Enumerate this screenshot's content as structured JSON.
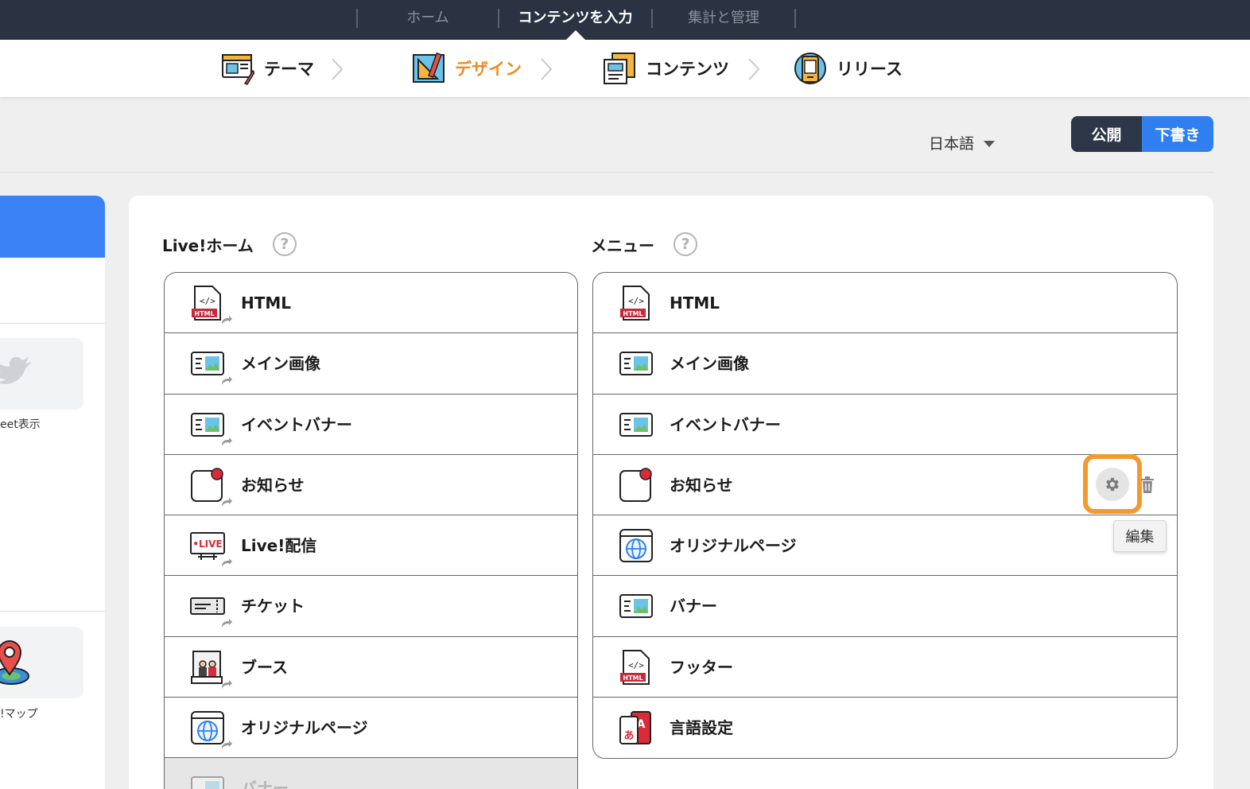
{
  "topnav": {
    "items": [
      "ホーム",
      "コンテンツを入力",
      "集計と管理"
    ],
    "active": "コンテンツを入力"
  },
  "steps": [
    {
      "label": "テーマ",
      "icon": "theme-icon"
    },
    {
      "label": "デザイン",
      "icon": "design-icon",
      "active": true
    },
    {
      "label": "コンテンツ",
      "icon": "contents-icon"
    },
    {
      "label": "リリース",
      "icon": "release-icon"
    }
  ],
  "language": "日本語",
  "publish": {
    "public_label": "公開",
    "draft_label": "下書き",
    "selected": "下書き"
  },
  "sidebar": {
    "tiles": [
      {
        "label": "eet表示",
        "icon": "twitter-bird-icon"
      },
      {
        "label": "!マップ",
        "icon": "map-pin-icon"
      }
    ]
  },
  "home_column": {
    "title": "Live!ホーム",
    "items": [
      {
        "label": "HTML",
        "icon": "html-file-icon"
      },
      {
        "label": "メイン画像",
        "icon": "image-card-icon"
      },
      {
        "label": "イベントバナー",
        "icon": "image-card-icon"
      },
      {
        "label": "お知らせ",
        "icon": "notification-icon"
      },
      {
        "label": "Live!配信",
        "icon": "live-icon"
      },
      {
        "label": "チケット",
        "icon": "ticket-icon"
      },
      {
        "label": "ブース",
        "icon": "booth-icon"
      },
      {
        "label": "オリジナルページ",
        "icon": "globe-page-icon"
      },
      {
        "label": "バナー",
        "icon": "image-card-icon",
        "disabled": true
      }
    ]
  },
  "menu_column": {
    "title": "メニュー",
    "items": [
      {
        "label": "HTML",
        "icon": "html-file-icon"
      },
      {
        "label": "メイン画像",
        "icon": "image-card-icon"
      },
      {
        "label": "イベントバナー",
        "icon": "image-card-icon"
      },
      {
        "label": "お知らせ",
        "icon": "notification-icon"
      },
      {
        "label": "オリジナルページ",
        "icon": "globe-page-icon"
      },
      {
        "label": "バナー",
        "icon": "image-card-icon"
      },
      {
        "label": "フッター",
        "icon": "html-file-icon"
      },
      {
        "label": "言語設定",
        "icon": "language-icon"
      }
    ]
  },
  "tooltip": {
    "text": "編集"
  },
  "colors": {
    "accent_orange": "#f39a2f",
    "nav_bg": "#2b3342",
    "draft_blue": "#2f7ff0"
  }
}
